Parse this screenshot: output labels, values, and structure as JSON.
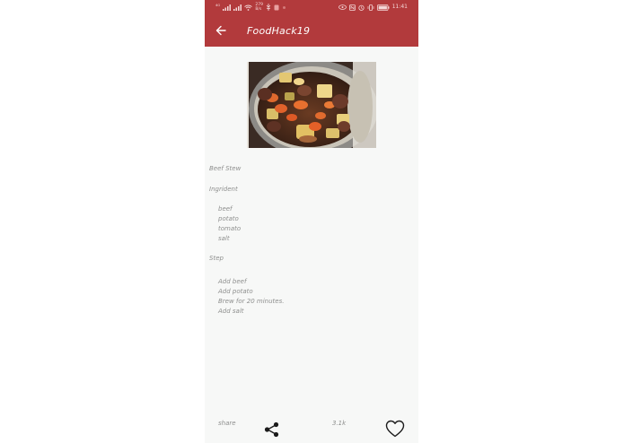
{
  "status_bar": {
    "network_left": "⁴ᴳ",
    "speed_top": "279",
    "speed_bottom": "B/s",
    "time": "11:41"
  },
  "appbar": {
    "title": "FoodHack19",
    "back_icon": "arrow-left-icon"
  },
  "recipe": {
    "name": "Beef Stew",
    "ingredient_heading": "Ingrident",
    "ingredients": [
      "beef",
      "potato",
      "tomato",
      "salt"
    ],
    "step_heading": "Step",
    "steps": [
      "Add beef",
      "Add potato",
      "Brew for 20 minutes.",
      "Add salt"
    ]
  },
  "footer": {
    "share_label": "share",
    "like_count": "3.1k",
    "share_icon": "share-icon",
    "like_icon": "heart-icon"
  },
  "colors": {
    "accent": "#b23a3c",
    "background": "#f7f8f7",
    "text": "#8e8f8e"
  }
}
